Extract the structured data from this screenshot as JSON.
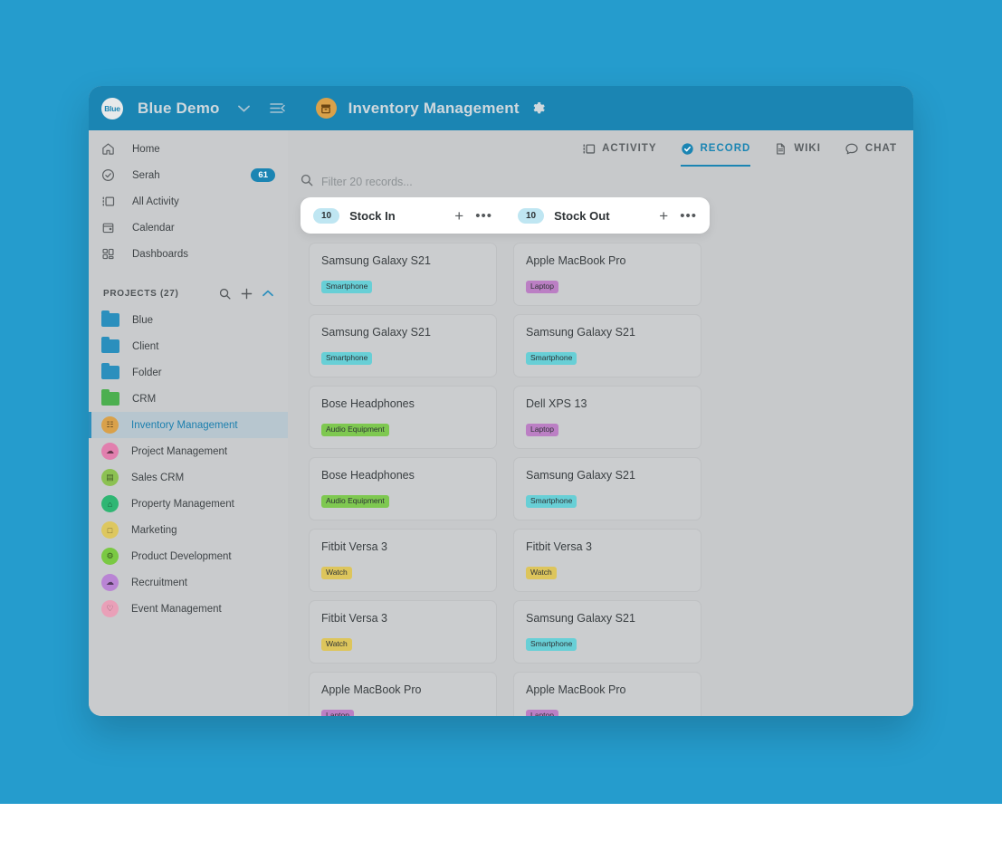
{
  "theme": {
    "page_background": "#259ccd",
    "accent": "#1b85b3",
    "window_background": "#c7c9cb",
    "sidebar_background": "#c9cbcd"
  },
  "topbar": {
    "logo_text": "Blue",
    "workspace_name": "Blue Demo",
    "workspace_chevron": "chevron-down",
    "collapse_icon": "collapse-sidebar",
    "project_icon": "inventory-box",
    "project_title": "Inventory Management",
    "settings_icon": "gear"
  },
  "sidebar": {
    "nav": [
      {
        "icon": "home-icon",
        "label": "Home",
        "count": ""
      },
      {
        "icon": "check-circle-icon",
        "label": "Serah",
        "count": "61"
      },
      {
        "icon": "activity-icon",
        "label": "All Activity",
        "count": ""
      },
      {
        "icon": "calendar-icon",
        "label": "Calendar",
        "count": ""
      },
      {
        "icon": "dashboard-icon",
        "label": "Dashboards",
        "count": ""
      }
    ],
    "projects_header": {
      "title": "PROJECTS (27)",
      "search_icon": "search-icon",
      "add_icon": "plus-icon",
      "collapse_icon": "chevron-up-icon"
    },
    "projects": [
      {
        "label": "Blue",
        "type": "folder",
        "color": "#2b8fbd",
        "glyph": "",
        "active": false
      },
      {
        "label": "Client",
        "type": "folder",
        "color": "#2b8fbd",
        "glyph": "",
        "active": false
      },
      {
        "label": "Folder",
        "type": "folder",
        "color": "#2b8fbd",
        "glyph": "",
        "active": false
      },
      {
        "label": "CRM",
        "type": "folder",
        "color": "#4caf50",
        "glyph": "",
        "active": false
      },
      {
        "label": "Inventory Management",
        "type": "circle",
        "color": "#d9a14a",
        "glyph": "☷",
        "active": true
      },
      {
        "label": "Project Management",
        "type": "circle",
        "color": "#e17fae",
        "glyph": "☁",
        "active": false
      },
      {
        "label": "Sales CRM",
        "type": "circle",
        "color": "#8cc152",
        "glyph": "▤",
        "active": false
      },
      {
        "label": "Property Management",
        "type": "circle",
        "color": "#2fb673",
        "glyph": "⌂",
        "active": false
      },
      {
        "label": "Marketing",
        "type": "circle",
        "color": "#ddc75f",
        "glyph": "□",
        "active": false
      },
      {
        "label": "Product Development",
        "type": "circle",
        "color": "#7ac943",
        "glyph": "⚙",
        "active": false
      },
      {
        "label": "Recruitment",
        "type": "circle",
        "color": "#b984d4",
        "glyph": "☁",
        "active": false
      },
      {
        "label": "Event Management",
        "type": "circle",
        "color": "#e9a0b8",
        "glyph": "♡",
        "active": false
      }
    ]
  },
  "tabs": [
    {
      "label": "ACTIVITY",
      "icon": "activity-icon",
      "active": false
    },
    {
      "label": "RECORD",
      "icon": "check-circle-icon",
      "active": true
    },
    {
      "label": "WIKI",
      "icon": "document-icon",
      "active": false
    },
    {
      "label": "CHAT",
      "icon": "chat-bubble-icon",
      "active": false
    }
  ],
  "filter": {
    "icon": "search-icon",
    "placeholder": "Filter 20 records...",
    "value": ""
  },
  "board": {
    "add_column_label": "+",
    "columns": [
      {
        "name": "Stock In",
        "count": "10",
        "add_icon": "plus-icon",
        "more_icon": "ellipsis-icon",
        "cards": [
          {
            "title": "Samsung Galaxy S21",
            "tag": "Smartphone",
            "tag_color": "#68cfd6"
          },
          {
            "title": "Samsung Galaxy S21",
            "tag": "Smartphone",
            "tag_color": "#68cfd6"
          },
          {
            "title": "Bose Headphones",
            "tag": "Audio Equipment",
            "tag_color": "#7ec850"
          },
          {
            "title": "Bose Headphones",
            "tag": "Audio Equipment",
            "tag_color": "#7ec850"
          },
          {
            "title": "Fitbit Versa 3",
            "tag": "Watch",
            "tag_color": "#ddc55c"
          },
          {
            "title": "Fitbit Versa 3",
            "tag": "Watch",
            "tag_color": "#ddc55c"
          },
          {
            "title": "Apple MacBook Pro",
            "tag": "Laptop",
            "tag_color": "#bb7fc4"
          }
        ]
      },
      {
        "name": "Stock Out",
        "count": "10",
        "add_icon": "plus-icon",
        "more_icon": "ellipsis-icon",
        "cards": [
          {
            "title": "Apple MacBook Pro",
            "tag": "Laptop",
            "tag_color": "#bb7fc4"
          },
          {
            "title": "Samsung Galaxy S21",
            "tag": "Smartphone",
            "tag_color": "#68cfd6"
          },
          {
            "title": "Dell XPS 13",
            "tag": "Laptop",
            "tag_color": "#bb7fc4"
          },
          {
            "title": "Samsung Galaxy S21",
            "tag": "Smartphone",
            "tag_color": "#68cfd6"
          },
          {
            "title": "Fitbit Versa 3",
            "tag": "Watch",
            "tag_color": "#ddc55c"
          },
          {
            "title": "Samsung Galaxy S21",
            "tag": "Smartphone",
            "tag_color": "#68cfd6"
          },
          {
            "title": "Apple MacBook Pro",
            "tag": "Laptop",
            "tag_color": "#bb7fc4"
          }
        ]
      }
    ]
  }
}
